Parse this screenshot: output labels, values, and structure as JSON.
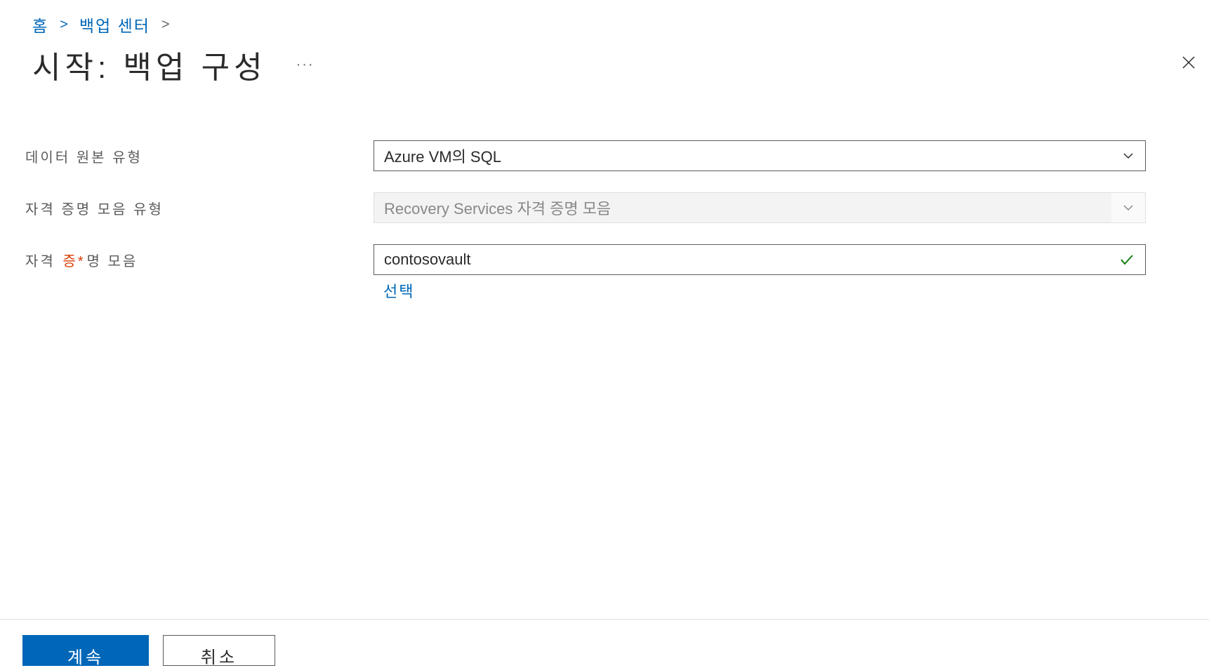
{
  "breadcrumb": {
    "home": "홈",
    "backup_center": "백업 센터"
  },
  "page_title": "시작: 백업 구성",
  "form": {
    "datasource_type": {
      "label": "데이터 원본 유형",
      "value": "Azure VM의 SQL"
    },
    "vault_type": {
      "label": "자격 증명 모음 유형",
      "value": "Recovery Services 자격 증명 모음"
    },
    "vault": {
      "label_before": "자격 ",
      "label_after": "명 모음",
      "value": "contosovault",
      "select_link": "선택"
    }
  },
  "footer": {
    "continue": "계속",
    "cancel": "취소"
  }
}
